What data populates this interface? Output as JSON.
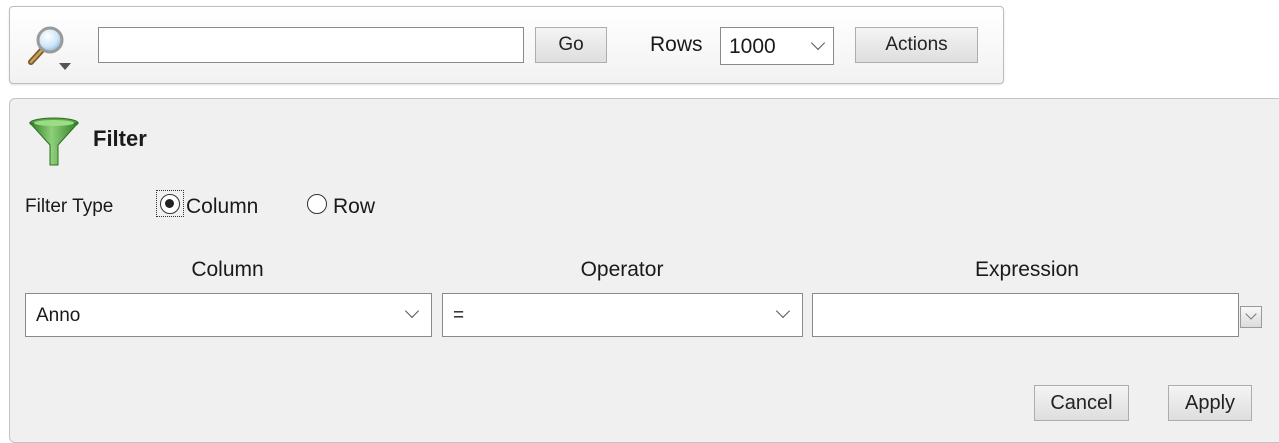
{
  "toolbar": {
    "search_icon": "magnifier-dropdown-icon",
    "search_value": "",
    "go_label": "Go",
    "rows_label": "Rows",
    "rows_value": "1000",
    "actions_label": "Actions"
  },
  "filter": {
    "icon": "funnel-icon",
    "title": "Filter",
    "filter_type_label": "Filter Type",
    "options": [
      {
        "label": "Column",
        "checked": true
      },
      {
        "label": "Row",
        "checked": false
      }
    ],
    "headers": {
      "column": "Column",
      "operator": "Operator",
      "expression": "Expression"
    },
    "column_value": "Anno",
    "operator_value": "=",
    "expression_value": "",
    "cancel_label": "Cancel",
    "apply_label": "Apply"
  },
  "colors": {
    "panel_background": "#f0f0f0",
    "funnel_green": "#3a8f2a",
    "border": "#8a8a8a"
  }
}
